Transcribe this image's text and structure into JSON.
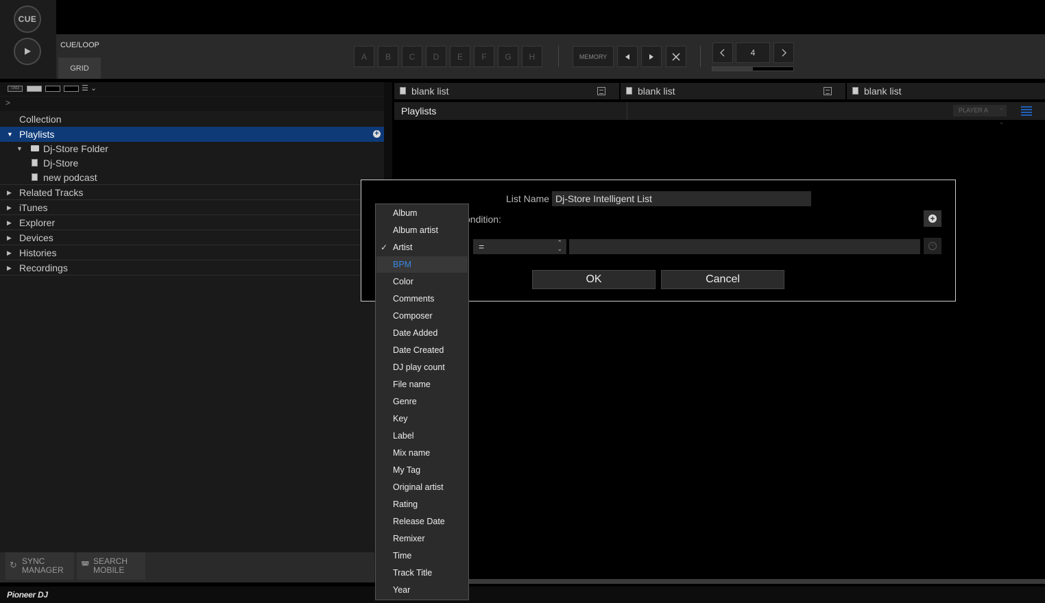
{
  "transport": {
    "cue_label": "CUE",
    "play_icon": "play-icon"
  },
  "top_bar": {
    "cue_loop_label": "CUE/LOOP",
    "grid_tab": "GRID",
    "hot_cues": [
      "A",
      "B",
      "C",
      "D",
      "E",
      "F",
      "G",
      "H"
    ],
    "memory_label": "MEMORY",
    "beat_value": "4",
    "beat_progress": 0.5
  },
  "browser": {
    "tag_label": "TAG",
    "tree": {
      "collection": "Collection",
      "playlists": "Playlists",
      "folder": "Dj-Store Folder",
      "playlist_1": "Dj-Store",
      "playlist_2": "new podcast",
      "related_tracks": "Related Tracks",
      "itunes": "iTunes",
      "explorer": "Explorer",
      "devices": "Devices",
      "histories": "Histories",
      "recordings": "Recordings"
    }
  },
  "bottom_left": {
    "sync_line1": "SYNC",
    "sync_line2": "MANAGER",
    "search_line1": "SEARCH",
    "search_line2": "MOBILE"
  },
  "footer": {
    "logo": "Pioneer DJ"
  },
  "tabs": [
    "blank list",
    "blank list",
    "blank list"
  ],
  "playlist_panel": {
    "title": "Playlists",
    "player_select": "PLAYER A"
  },
  "dialog": {
    "list_name_label": "List Name",
    "list_name_value": "Dj-Store Intelligent List",
    "condition_label": "ondition:",
    "operator_value": "=",
    "condition_value": "",
    "ok_label": "OK",
    "cancel_label": "Cancel"
  },
  "dropdown": {
    "items": [
      "Album",
      "Album artist",
      "Artist",
      "BPM",
      "Color",
      "Comments",
      "Composer",
      "Date Added",
      "Date Created",
      "DJ play count",
      "File name",
      "Genre",
      "Key",
      "Label",
      "Mix name",
      "My Tag",
      "Original artist",
      "Rating",
      "Release Date",
      "Remixer",
      "Time",
      "Track Title",
      "Year"
    ],
    "checked_index": 2,
    "highlighted_index": 3,
    "highlight_color": "#3a86e0"
  }
}
